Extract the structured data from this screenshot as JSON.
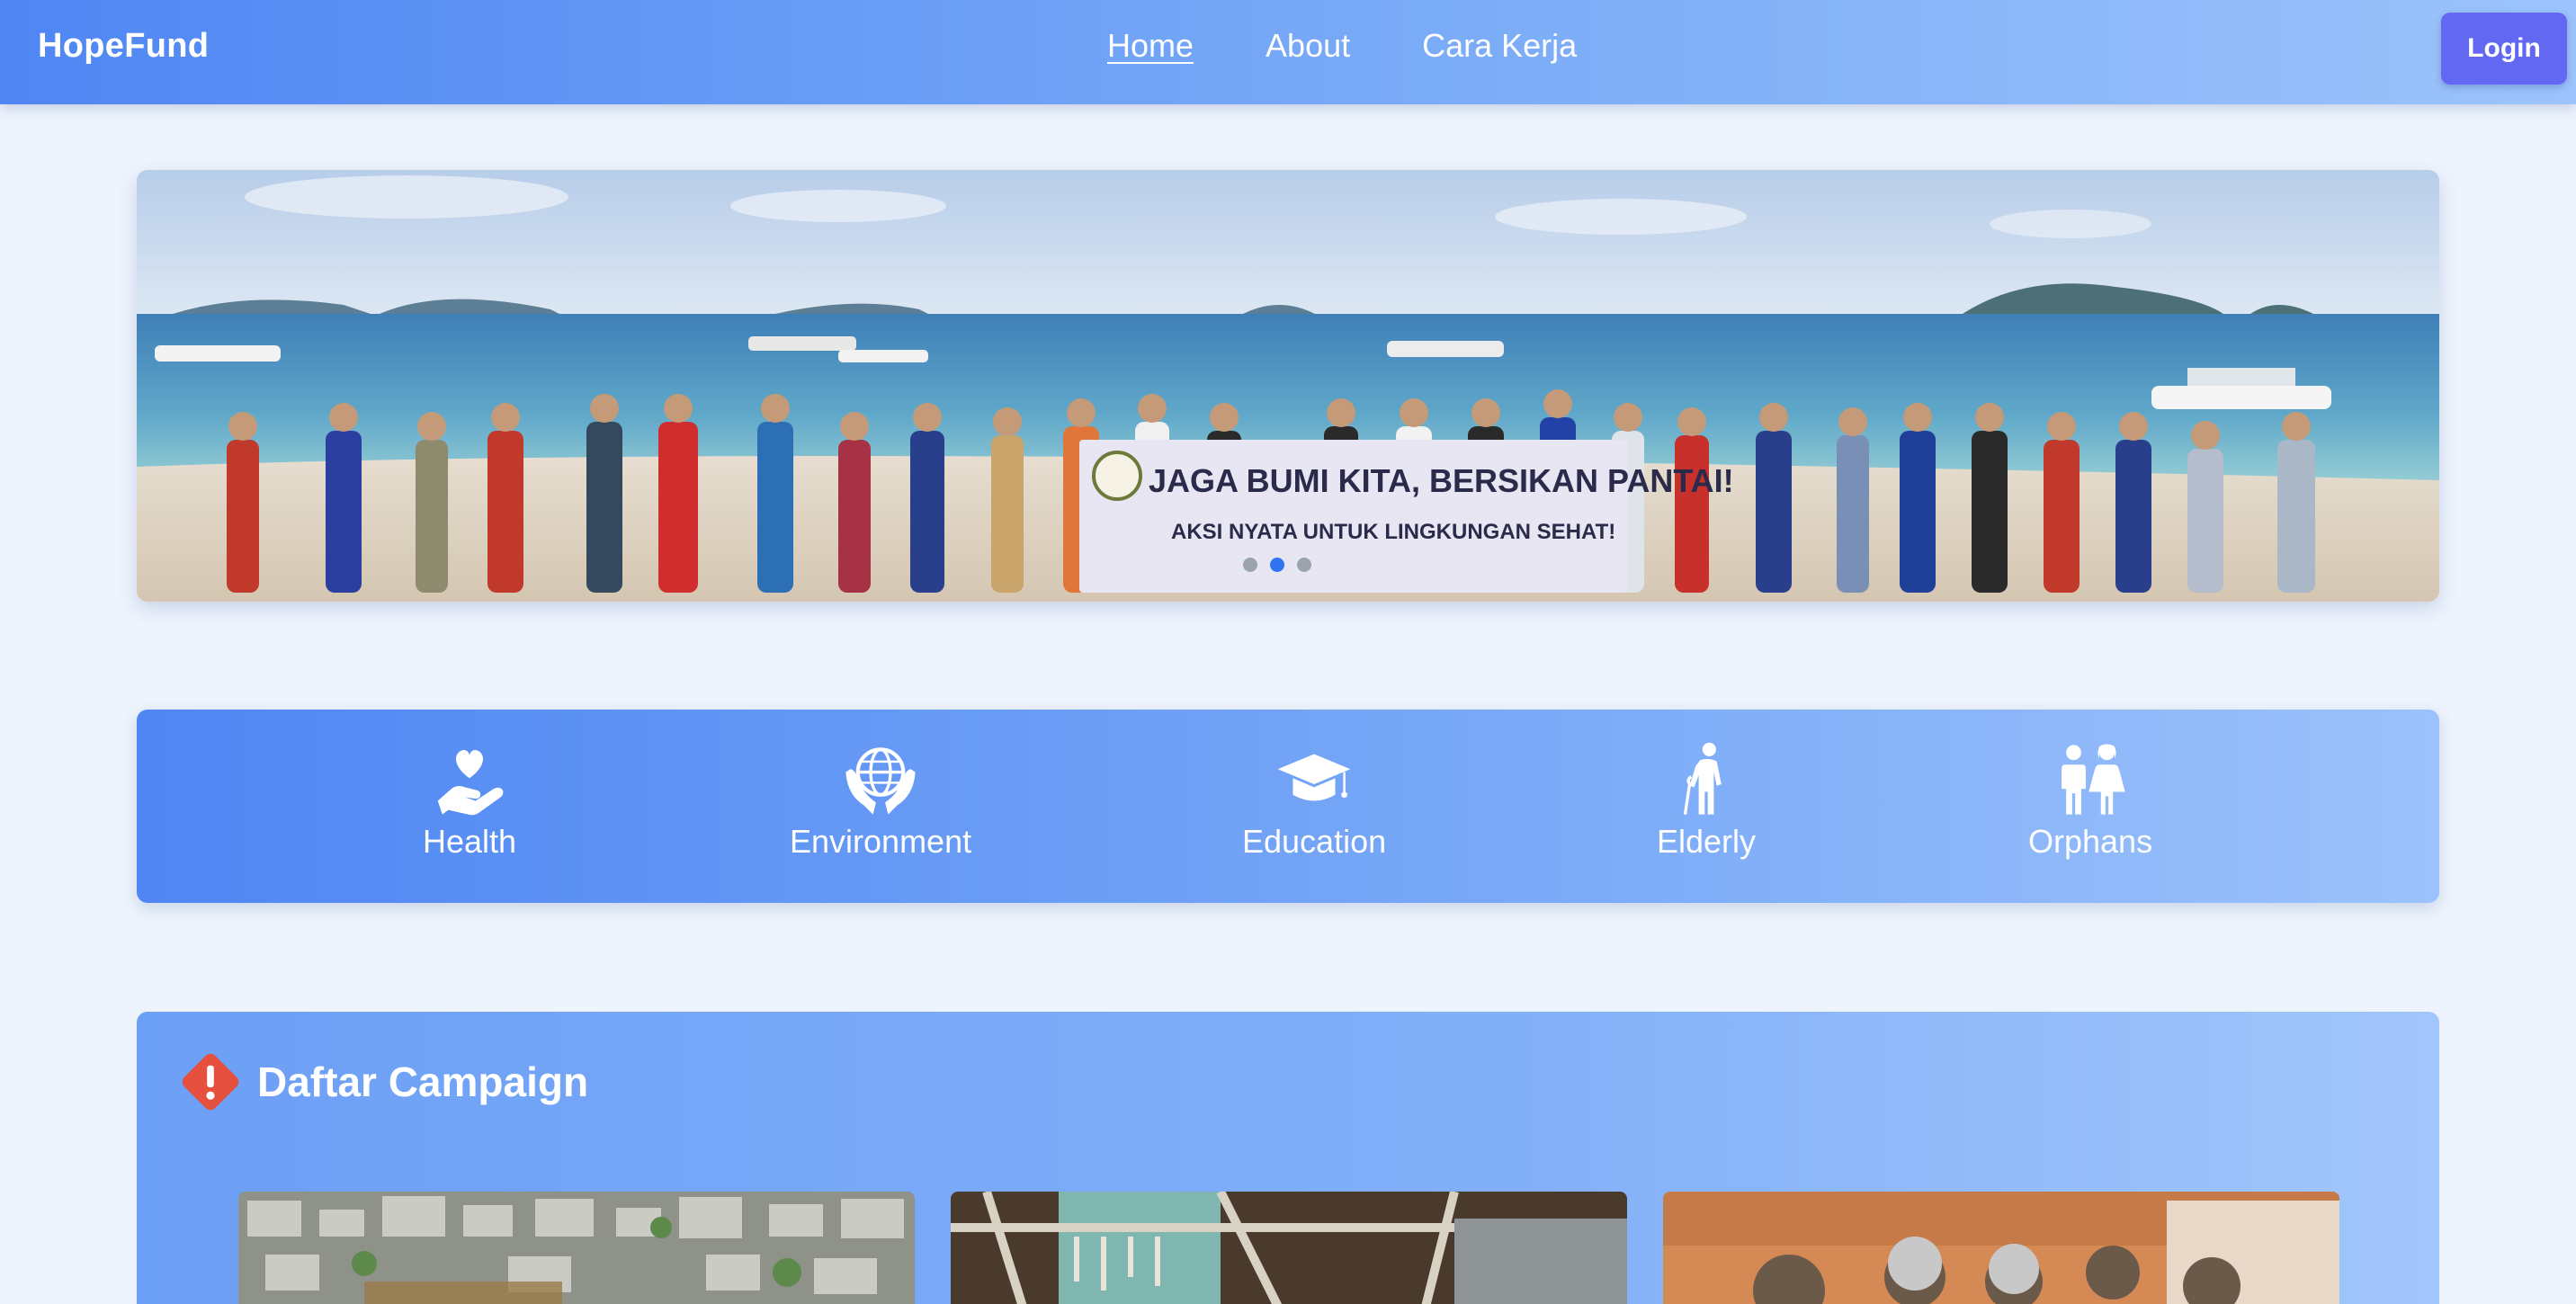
{
  "navbar": {
    "brand": "HopeFund",
    "links": [
      {
        "label": "Home",
        "active": true
      },
      {
        "label": "About",
        "active": false
      },
      {
        "label": "Cara Kerja",
        "active": false
      }
    ],
    "login_label": "Login"
  },
  "hero": {
    "banner_line1": "JAGA BUMI KITA, BERSIKAN PANTAI!",
    "banner_line2": "AKSI NYATA UNTUK LINGKUNGAN SEHAT!",
    "slides": 3,
    "active_slide": 1
  },
  "categories": [
    {
      "label": "Health",
      "icon": "heart-hand-icon"
    },
    {
      "label": "Environment",
      "icon": "globe-hands-icon"
    },
    {
      "label": "Education",
      "icon": "graduation-cap-icon"
    },
    {
      "label": "Elderly",
      "icon": "elderly-person-icon"
    },
    {
      "label": "Orphans",
      "icon": "children-icon"
    }
  ],
  "campaign": {
    "title": "Daftar Campaign",
    "icon": "warning-icon"
  },
  "colors": {
    "navbar_start": "#4f86f3",
    "navbar_end": "#9cc3fb",
    "login_button": "#6268f2",
    "page_background": "#eef4fd",
    "warning_icon": "#e5503f",
    "active_dot": "#2f73f0"
  }
}
